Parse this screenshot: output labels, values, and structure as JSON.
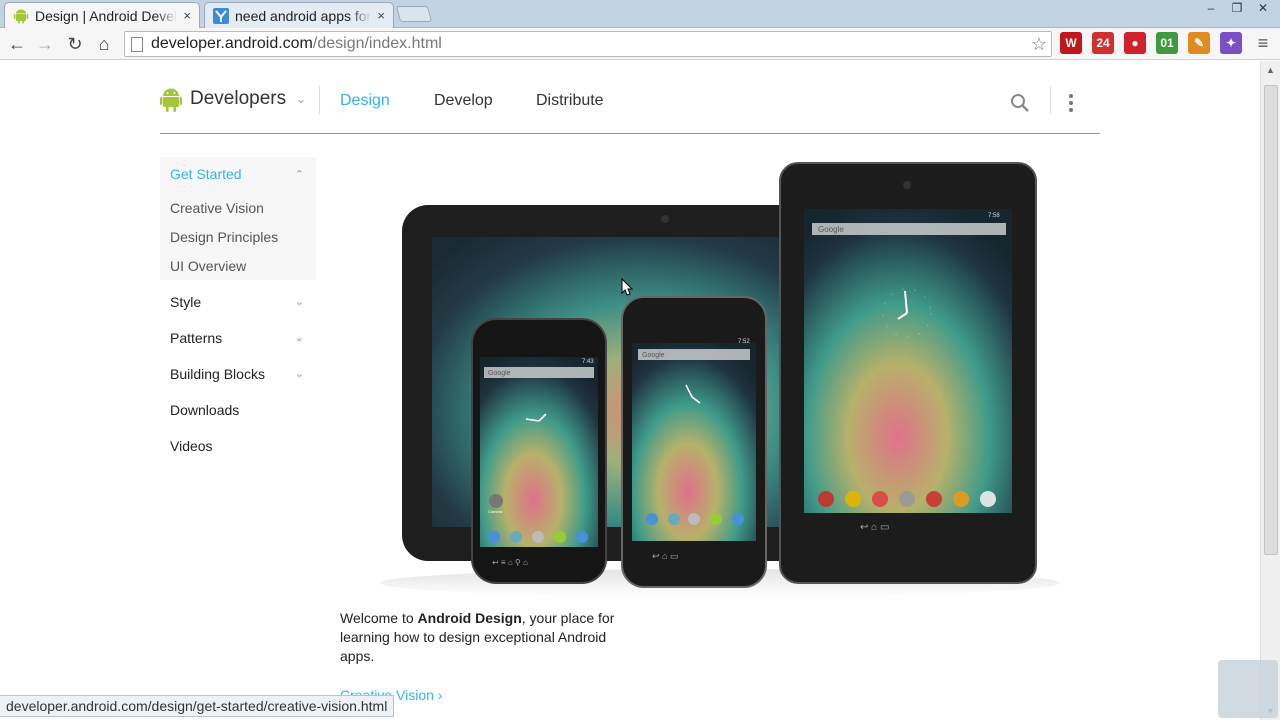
{
  "browser": {
    "tabs": [
      {
        "title": "Design | Android Developers",
        "close": "×",
        "active": true
      },
      {
        "title": "need android apps for",
        "close": "×",
        "active": false
      }
    ],
    "url_host": "developer.android.com",
    "url_path": "/design/index.html",
    "window_controls": {
      "minimize": "‒",
      "restore": "❐",
      "close": "✕"
    },
    "nav": {
      "back": "←",
      "forward": "→",
      "reload": "↻",
      "home": "⌂"
    },
    "star": "☆",
    "extensions": [
      {
        "name": "w-extension-icon",
        "label": "W",
        "color": "#c0171c"
      },
      {
        "name": "24-extension-icon",
        "label": "24",
        "color": "#d03030"
      },
      {
        "name": "stop-extension-icon",
        "label": "●",
        "color": "#d0222a"
      },
      {
        "name": "counter-extension-icon",
        "label": "01",
        "color": "#3d9b3d"
      },
      {
        "name": "pencil-extension-icon",
        "label": "✎",
        "color": "#e08a20"
      },
      {
        "name": "color-wheel-extension-icon",
        "label": "✦",
        "color": "#7a4fc4"
      },
      {
        "name": "menu-icon",
        "label": "≡",
        "color": "#555"
      }
    ],
    "status_url": "developer.android.com/design/get-started/creative-vision.html"
  },
  "site": {
    "logo_text": "Developers",
    "logo_chevron": "⌄",
    "nav": [
      {
        "label": "Design",
        "active": true
      },
      {
        "label": "Develop",
        "active": false
      },
      {
        "label": "Distribute",
        "active": false
      }
    ],
    "accent": "#33b5e5"
  },
  "sidebar": {
    "open_section": {
      "label": "Get Started",
      "caret": "⌃",
      "items": [
        "Creative Vision",
        "Design Principles",
        "UI Overview"
      ]
    },
    "items": [
      {
        "label": "Style",
        "caret": "⌄"
      },
      {
        "label": "Patterns",
        "caret": "⌄"
      },
      {
        "label": "Building Blocks",
        "caret": "⌄"
      },
      {
        "label": "Downloads",
        "caret": ""
      },
      {
        "label": "Videos",
        "caret": ""
      }
    ]
  },
  "hero": {
    "devices": [
      {
        "name": "tablet-landscape"
      },
      {
        "name": "phone-nexus-s",
        "time": "7:43",
        "search": "Google"
      },
      {
        "name": "phone-galaxy-nexus",
        "time": "7:52",
        "search": "Google"
      },
      {
        "name": "tablet-nexus-7",
        "time": "7:58",
        "search": "Google"
      }
    ],
    "camera_label": "Camera"
  },
  "content": {
    "welcome_prefix": "Welcome to ",
    "welcome_bold": "Android Design",
    "welcome_suffix": ", your place for learning how to design exceptional Android apps.",
    "link_label": "Creative Vision",
    "link_chevron": "›"
  }
}
